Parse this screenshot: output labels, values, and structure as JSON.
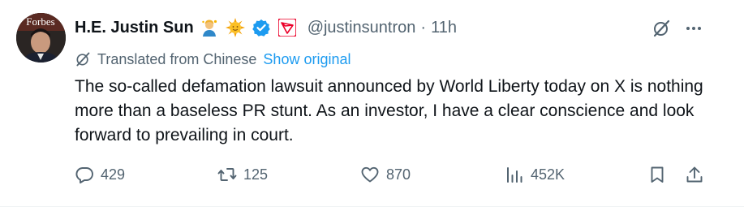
{
  "author": {
    "name": "H.E. Justin Sun",
    "handle": "@justinsuntron",
    "separator": "·",
    "time": "11h",
    "avatar_text": "Forbes"
  },
  "translation": {
    "label": "Translated from Chinese",
    "show_original": "Show original"
  },
  "tweet": {
    "text": "The so-called defamation lawsuit announced by World Liberty today on X is nothing more than a baseless PR stunt. As an investor, I have a clear conscience and look forward to prevailing in court."
  },
  "actions": {
    "replies": "429",
    "reposts": "125",
    "likes": "870",
    "views": "452K"
  },
  "colors": {
    "text": "#0f1419",
    "secondary": "#536471",
    "link": "#1d9bf0",
    "verified": "#1d9bf0",
    "tron_red": "#eb0029"
  },
  "icons": {
    "header": [
      "person-emoji-icon",
      "sun-emoji-icon",
      "verified-badge-icon",
      "tron-logo-icon"
    ],
    "grok": "grok-icon",
    "more": "more-icon",
    "translate": "translate-icon",
    "reply": "reply-icon",
    "repost": "repost-icon",
    "like": "heart-icon",
    "views": "views-icon",
    "bookmark": "bookmark-icon",
    "share": "share-icon"
  }
}
